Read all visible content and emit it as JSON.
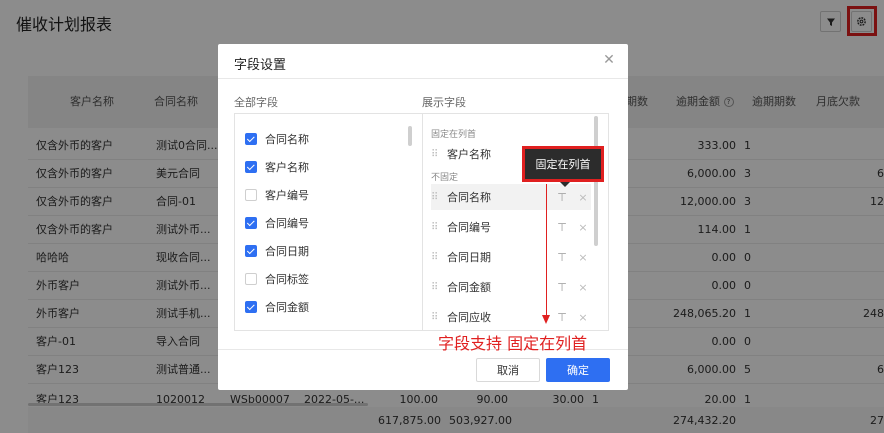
{
  "page": {
    "title": "催收计划报表"
  },
  "toolbar": {
    "filter_icon": "funnel-icon",
    "settings_icon": "gear-icon"
  },
  "table": {
    "headers": {
      "customer_name": "客户名称",
      "contract_name": "合同名称",
      "periods": "期数",
      "overdue_amount": "逾期金额",
      "overdue_periods": "逾期期数",
      "month_end_owed": "月底欠款"
    },
    "rows": [
      {
        "customer": "仅含外币的客户",
        "contract": "测试0合同...",
        "overdue_amount": "333.00",
        "overdue_periods": "1",
        "owed": ""
      },
      {
        "customer": "仅含外币的客户",
        "contract": "美元合同",
        "overdue_amount": "6,000.00",
        "overdue_periods": "3",
        "owed": "6"
      },
      {
        "customer": "仅含外币的客户",
        "contract": "合同-01",
        "overdue_amount": "12,000.00",
        "overdue_periods": "3",
        "owed": "12"
      },
      {
        "customer": "仅含外币的客户",
        "contract": "测试外币...",
        "overdue_amount": "114.00",
        "overdue_periods": "1",
        "owed": ""
      },
      {
        "customer": "哈哈哈",
        "contract": "现收合同...",
        "overdue_amount": "0.00",
        "overdue_periods": "0",
        "owed": ""
      },
      {
        "customer": "外币客户",
        "contract": "测试外币...",
        "overdue_amount": "0.00",
        "overdue_periods": "0",
        "owed": ""
      },
      {
        "customer": "外币客户",
        "contract": "测试手机...",
        "overdue_amount": "248,065.20",
        "overdue_periods": "1",
        "owed": "248"
      },
      {
        "customer": "客户-01",
        "contract": "导入合同",
        "overdue_amount": "0.00",
        "overdue_periods": "0",
        "owed": ""
      },
      {
        "customer": "客户123",
        "contract": "测试普通...",
        "overdue_amount": "6,000.00",
        "overdue_periods": "5",
        "owed": "6"
      }
    ],
    "last_row": {
      "customer": "客户123",
      "contract": "1020012",
      "code": "WSb00007",
      "date": "2022-05-...",
      "amount": "100.00",
      "received": "90.00",
      "periods": "30.00",
      "count": "1",
      "overdue_amount": "20.00",
      "overdue_periods": "1"
    },
    "summary": {
      "total1": "617,875.00",
      "total2": "503,927.00",
      "overdue_total": "274,432.20",
      "owed_total": "27"
    }
  },
  "modal": {
    "title": "字段设置",
    "close_icon": "close-icon",
    "all_fields_label": "全部字段",
    "display_fields_label": "展示字段",
    "all_fields": [
      {
        "label": "合同名称",
        "checked": true
      },
      {
        "label": "客户名称",
        "checked": true
      },
      {
        "label": "客户编号",
        "checked": false
      },
      {
        "label": "合同编号",
        "checked": true
      },
      {
        "label": "合同日期",
        "checked": true
      },
      {
        "label": "合同标签",
        "checked": false
      },
      {
        "label": "合同金额",
        "checked": true
      }
    ],
    "fixed_group_label": "固定在列首",
    "unfixed_group_label": "不固定",
    "fixed_fields": [
      {
        "label": "客户名称"
      }
    ],
    "unfixed_fields": [
      {
        "label": "合同名称"
      },
      {
        "label": "合同编号"
      },
      {
        "label": "合同日期"
      },
      {
        "label": "合同金额"
      },
      {
        "label": "合同应收"
      }
    ],
    "pin_symbol": "⊤",
    "remove_symbol": "×",
    "cancel_label": "取消",
    "ok_label": "确定"
  },
  "annotation": {
    "tooltip": "固定在列首",
    "caption": "字段支持  固定在列首",
    "color": "#e02020"
  }
}
